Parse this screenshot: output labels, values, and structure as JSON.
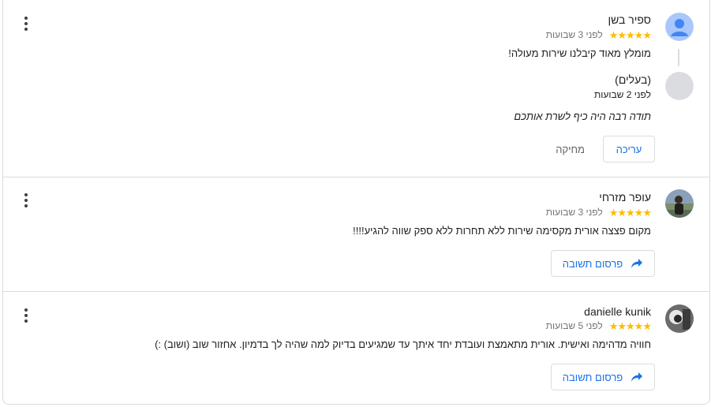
{
  "accent_color": "#1a73e8",
  "star_color": "#fbbc04",
  "reviews": [
    {
      "author": "ספיר בשן",
      "stars": "★★★★★",
      "rating": 5,
      "date": "לפני 3 שבועות",
      "text": "מומלץ מאוד קיבלנו שירות מעולה!",
      "avatar": "default-person-icon",
      "owner_reply": {
        "author": "(בעלים)",
        "date": "לפני 2 שבועות",
        "text": "תודה רבה היה כיף לשרת אותכם"
      },
      "actions": {
        "edit": "עריכה",
        "delete": "מחיקה"
      }
    },
    {
      "author": "עופר מזרחי",
      "stars": "★★★★★",
      "rating": 5,
      "date": "לפני 3 שבועות",
      "text": "מקום פצצה אורית מקסימה שירות ללא תחרות ללא ספק שווה להגיע!!!!",
      "avatar": "photo-avatar",
      "reply_button": "פרסום תשובה"
    },
    {
      "author": "danielle kunik",
      "stars": "★★★★★",
      "rating": 5,
      "date": "לפני 5 שבועות",
      "text": "חוויה מדהימה ואישית. אורית מתאמצת ועובדת יחד איתך עד שמגיעים בדיוק למה שהיה לך בדמיון. אחזור שוב (ושוב) :)",
      "avatar": "photo-avatar",
      "reply_button": "פרסום תשובה"
    }
  ]
}
